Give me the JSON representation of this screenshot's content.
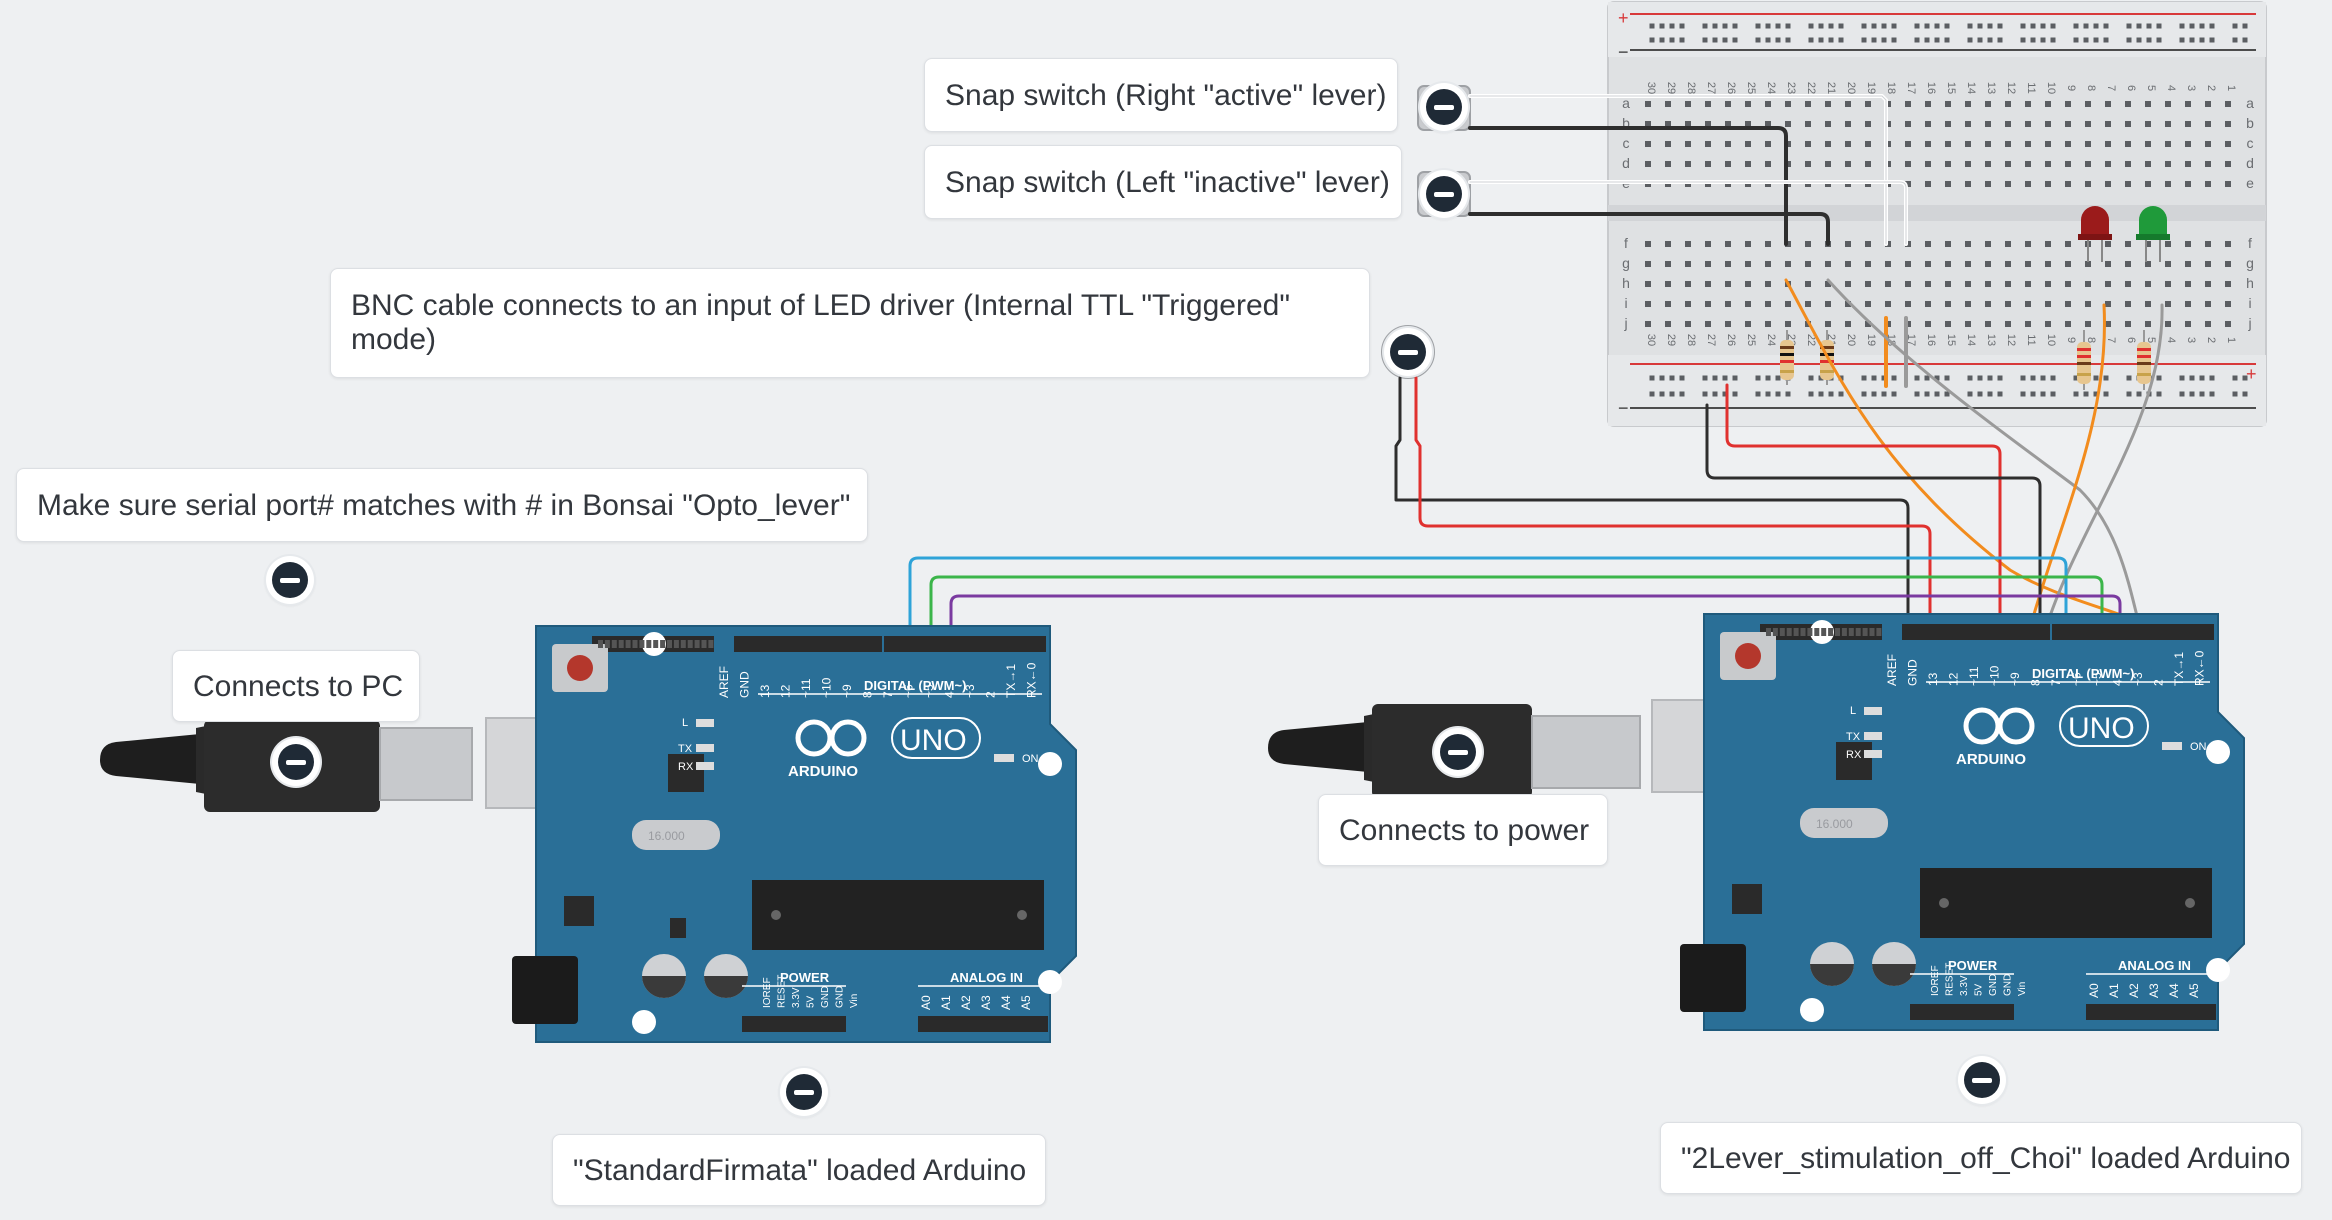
{
  "annotations": {
    "right_lever": "Snap switch (Right \"active\" lever)",
    "left_lever": "Snap switch (Left \"inactive\" lever)",
    "bnc": "BNC cable connects to an input of LED driver (Internal TTL \"Triggered\" mode)",
    "serial": "Make sure serial port# matches with # in Bonsai \"Opto_lever\"",
    "pc": "Connects to PC",
    "power": "Connects to power",
    "left_board": "\"StandardFirmata\" loaded Arduino",
    "right_board": "\"2Lever_stimulation_off_Choi\" loaded Arduino"
  },
  "board_labels": {
    "digital": "DIGITAL (PWM~)",
    "brand": "ARDUINO",
    "model": "UNO",
    "on": "ON",
    "power": "POWER",
    "analog_in": "ANALOG IN",
    "l": "L",
    "tx": "TX",
    "rx": "RX",
    "crystal": "16.000",
    "digital_pins": [
      "AREF",
      "GND",
      "13",
      "12",
      "~11",
      "~10",
      "~9",
      "8",
      "7",
      "~6",
      "~5",
      "4",
      "~3",
      "2",
      "TX→1",
      "RX←0"
    ],
    "power_pins": [
      "IOREF",
      "RESET",
      "3.3V",
      "5V",
      "GND",
      "GND",
      "Vin"
    ],
    "analog_pins": [
      "A0",
      "A1",
      "A2",
      "A3",
      "A4",
      "A5"
    ]
  },
  "breadboard": {
    "rows_top": [
      "a",
      "b",
      "c",
      "d",
      "e"
    ],
    "rows_bottom": [
      "f",
      "g",
      "h",
      "i",
      "j"
    ],
    "columns": [
      "30",
      "29",
      "28",
      "27",
      "26",
      "25",
      "24",
      "23",
      "22",
      "21",
      "20",
      "19",
      "18",
      "17",
      "16",
      "15",
      "14",
      "13",
      "12",
      "11",
      "10",
      "9",
      "8",
      "7",
      "6",
      "5",
      "4",
      "3",
      "2",
      "1"
    ],
    "plus": "+",
    "minus": "−"
  },
  "colors": {
    "background": "#eef0f2",
    "board_blue": "#2a6f97",
    "wire_red": "#e0312f",
    "wire_black": "#2e2e2e",
    "wire_orange": "#f28c1e",
    "wire_gray": "#9a9a9a",
    "wire_white": "#ffffff",
    "wire_blue": "#2ea3d8",
    "wire_green": "#3bb54a",
    "wire_purple": "#7a3aa0",
    "led_red": "#9b1b1b",
    "led_green": "#1f9a3a",
    "pin_icon": "#1f2a36"
  },
  "icons": [
    "remove-circle-icon",
    "usb-plug-icon",
    "dc-jack-icon",
    "reset-button-icon"
  ]
}
